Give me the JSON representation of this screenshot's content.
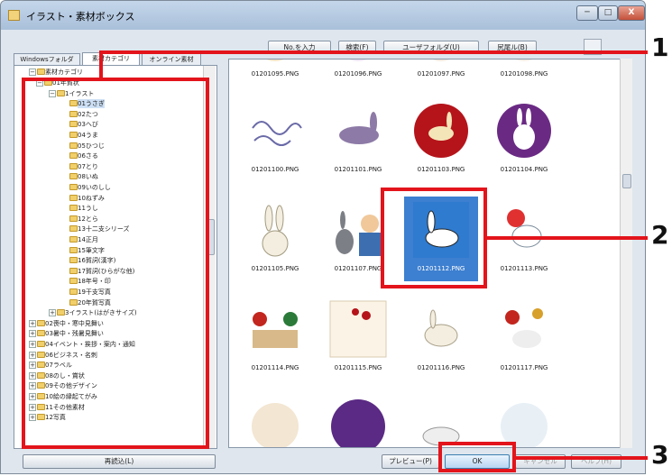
{
  "window": {
    "title": "イラスト・素材ボックス",
    "min_label": "─",
    "max_label": "□",
    "close_label": "X"
  },
  "toolbar": {
    "buttons": [
      "No.を入力",
      "検索(F)",
      "ユーザフォルダ(U)",
      "尻尾ル(B)"
    ]
  },
  "tabs": [
    "Windowsフォルダ",
    "素材カテゴリ",
    "オンライン素材"
  ],
  "tree": {
    "root": "素材カテゴリ",
    "items": [
      {
        "label": "01年賀状",
        "exp": "−"
      },
      {
        "label": "1イラスト",
        "exp": "−"
      },
      {
        "label": "01うさぎ",
        "exp": ""
      },
      {
        "label": "02たつ",
        "exp": ""
      },
      {
        "label": "03へび",
        "exp": ""
      },
      {
        "label": "04うま",
        "exp": ""
      },
      {
        "label": "05ひつじ",
        "exp": ""
      },
      {
        "label": "06さる",
        "exp": ""
      },
      {
        "label": "07とり",
        "exp": ""
      },
      {
        "label": "08いぬ",
        "exp": ""
      },
      {
        "label": "09いのしし",
        "exp": ""
      },
      {
        "label": "10ねずみ",
        "exp": ""
      },
      {
        "label": "11うし",
        "exp": ""
      },
      {
        "label": "12とら",
        "exp": ""
      },
      {
        "label": "13十二支シリーズ",
        "exp": ""
      },
      {
        "label": "14正月",
        "exp": ""
      },
      {
        "label": "15筆文字",
        "exp": ""
      },
      {
        "label": "16賀詞(漢字)",
        "exp": ""
      },
      {
        "label": "17賀詞(ひらがな他)",
        "exp": ""
      },
      {
        "label": "18年号・印",
        "exp": ""
      },
      {
        "label": "19干支写真",
        "exp": ""
      },
      {
        "label": "20年賀写真",
        "exp": ""
      },
      {
        "label": "3イラスト(はがきサイズ)",
        "exp": "+"
      },
      {
        "label": "02喪中・寒中見舞い",
        "exp": "+"
      },
      {
        "label": "03暑中・残暑見舞い",
        "exp": "+"
      },
      {
        "label": "04イベント・挨拶・案内・通知",
        "exp": "+"
      },
      {
        "label": "06ビジネス・名刺",
        "exp": "+"
      },
      {
        "label": "07ラベル",
        "exp": "+"
      },
      {
        "label": "08のし・賞状",
        "exp": "+"
      },
      {
        "label": "09その他デザイン",
        "exp": "+"
      },
      {
        "label": "10絵の縁起てがみ",
        "exp": "+"
      },
      {
        "label": "11その他素材",
        "exp": "+"
      },
      {
        "label": "12写真",
        "exp": "+"
      }
    ]
  },
  "grid": {
    "files": [
      "01201095.PNG",
      "01201096.PNG",
      "01201097.PNG",
      "01201098.PNG",
      "01201100.PNG",
      "01201101.PNG",
      "01201103.PNG",
      "01201104.PNG",
      "01201105.PNG",
      "01201107.PNG",
      "01201112.PNG",
      "01201113.PNG",
      "01201114.PNG",
      "01201115.PNG",
      "01201116.PNG",
      "01201117.PNG",
      "",
      "",
      "",
      ""
    ],
    "selected_index": 10
  },
  "buttons": {
    "reload": "再読込(L)",
    "preview": "プレビュー(P)",
    "ok": "OK",
    "cancel": "キャンセル",
    "help": "ヘルプ(H)"
  },
  "callouts": [
    "1",
    "2",
    "3"
  ],
  "colors": {
    "accent": "#e3141b",
    "selection": "#3d7fd0"
  }
}
